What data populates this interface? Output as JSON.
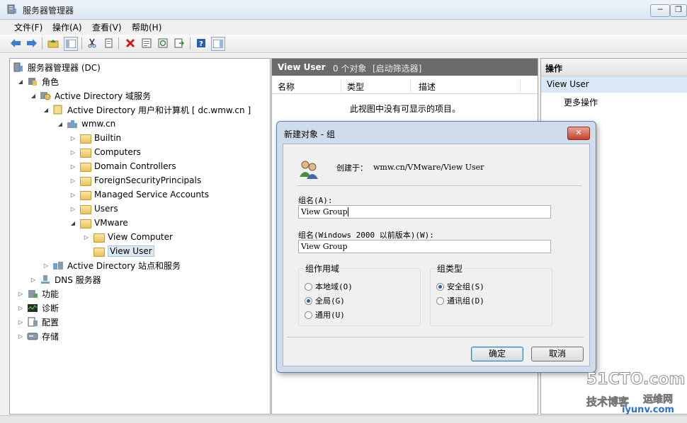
{
  "window": {
    "title": "服务器管理器"
  },
  "menu": [
    "文件(F)",
    "操作(A)",
    "查看(V)",
    "帮助(H)"
  ],
  "tree": {
    "root": "服务器管理器 (DC)",
    "roles": "角色",
    "ad_ds": "Active Directory 域服务",
    "aduc": "Active Directory 用户和计算机 [ dc.wmw.cn ]",
    "domain": "wmw.cn",
    "builtin": "Builtin",
    "computers": "Computers",
    "dc": "Domain Controllers",
    "fsp": "ForeignSecurityPrincipals",
    "msa": "Managed Service Accounts",
    "users": "Users",
    "vmware": "VMware",
    "view_computer": "View Computer",
    "view_user": "View User",
    "sites": "Active Directory 站点和服务",
    "dns": "DNS 服务器",
    "features": "功能",
    "diagnostics": "诊断",
    "configuration": "配置",
    "storage": "存储"
  },
  "center": {
    "name": "View User",
    "count": "0 个对象",
    "filter": "[启动筛选器]",
    "columns": [
      "名称",
      "类型",
      "描述"
    ],
    "empty": "此视图中没有可显示的项目。"
  },
  "actions": {
    "header": "操作",
    "selected": "View User",
    "more": "更多操作"
  },
  "dialog": {
    "title": "新建对象 - 组",
    "created_in_label": "创建于：",
    "created_in_value": "wmw.cn/VMware/View User",
    "group_name_label": "组名(A):",
    "group_name_value": "View Group",
    "group_name_pre2000_label": "组名(Windows 2000 以前版本)(W):",
    "group_name_pre2000_value": "View Group",
    "scope_title": "组作用域",
    "scope_local": "本地域(O)",
    "scope_global": "全局(G)",
    "scope_universal": "通用(U)",
    "type_title": "组类型",
    "type_security": "安全组(S)",
    "type_distribution": "通讯组(D)",
    "ok": "确定",
    "cancel": "取消"
  },
  "watermark": {
    "line1": "51CTO.com",
    "line2": "技术博客",
    "line3": "运维网",
    "line4": "iyunv.com"
  },
  "colors": {
    "selection": "#d9e7f6",
    "panel_header": "#6b6b6b",
    "dialog_frame": "#cfdcec",
    "close": "#c3412a"
  }
}
